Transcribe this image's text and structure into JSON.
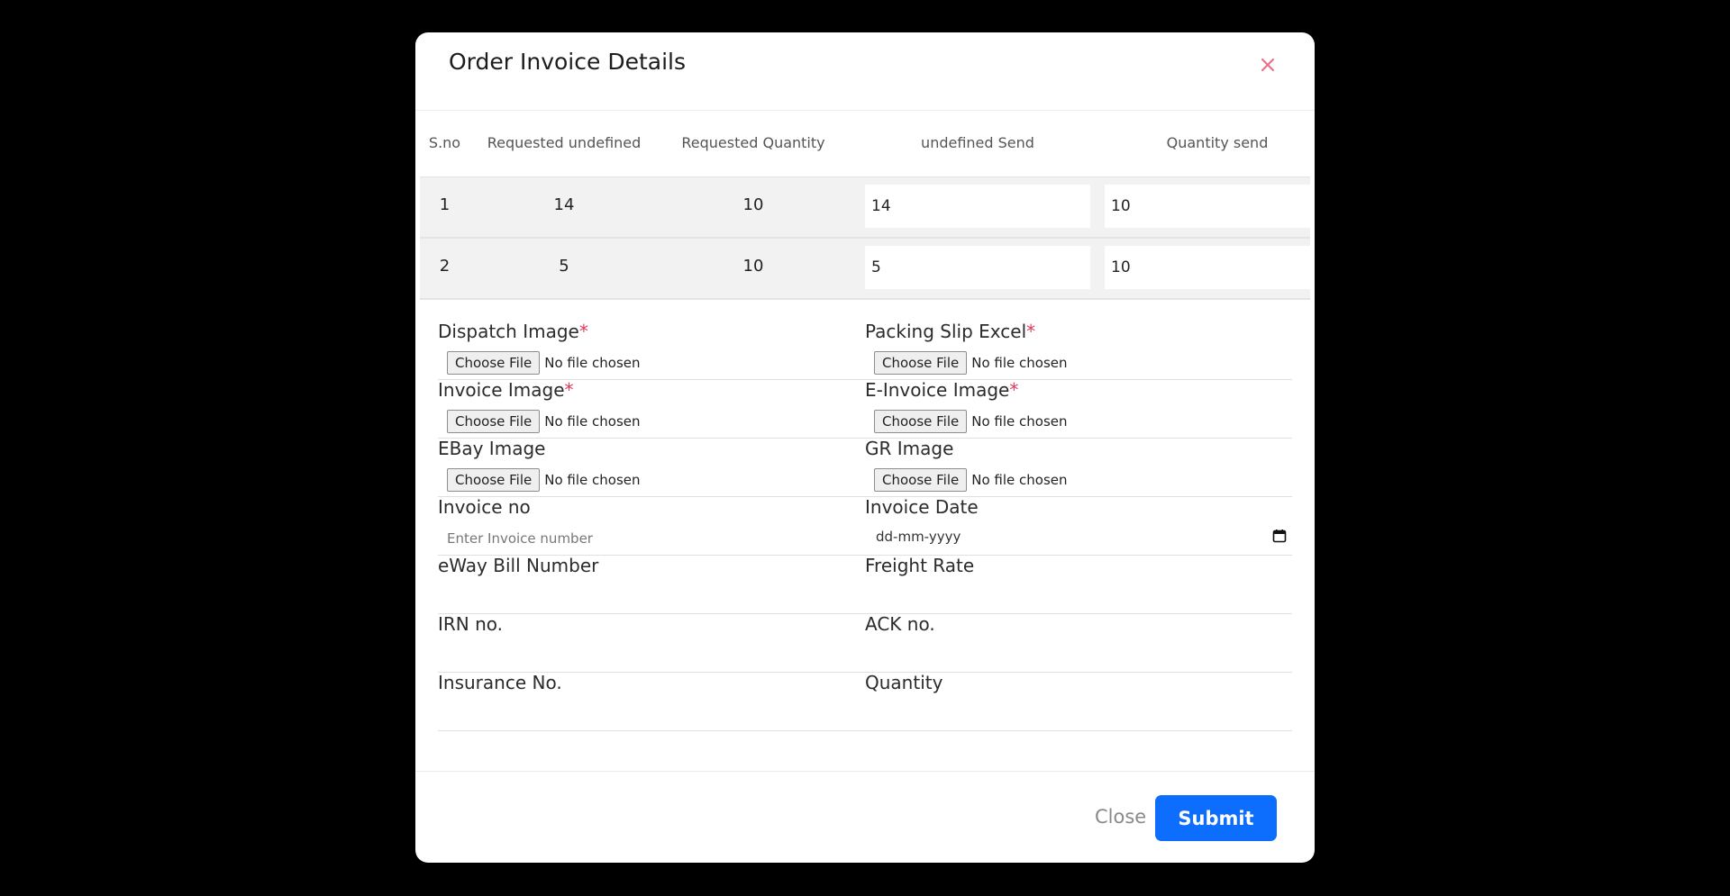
{
  "modal": {
    "title": "Order Invoice Details",
    "close_label": "Close",
    "submit_label": "Submit",
    "colors": {
      "accent": "#0d6efd",
      "required": "#e03a5b",
      "close_icon": "#e9738a"
    }
  },
  "table": {
    "headers": [
      "S.no",
      "Requested undefined",
      "Requested Quantity",
      "undefined Send",
      "Quantity send"
    ],
    "rows": [
      {
        "sno": "1",
        "requested_undefined": "14",
        "requested_quantity": "10",
        "undefined_send": "14",
        "quantity_send": "10"
      },
      {
        "sno": "2",
        "requested_undefined": "5",
        "requested_quantity": "10",
        "undefined_send": "5",
        "quantity_send": "10"
      }
    ]
  },
  "form": {
    "file_button_label": "Choose File",
    "no_file_text": "No file chosen",
    "required_mark": "*",
    "dispatch_image": "Dispatch Image",
    "packing_slip_excel": "Packing Slip Excel",
    "invoice_image": "Invoice Image",
    "e_invoice_image": "E-Invoice Image",
    "ebay_image": "EBay Image",
    "gr_image": "GR Image",
    "invoice_no": "Invoice no",
    "invoice_no_placeholder": "Enter Invoice number",
    "invoice_date": "Invoice Date",
    "invoice_date_placeholder": "dd-mm-yyyy",
    "eway_bill_number": "eWay Bill Number",
    "freight_rate": "Freight Rate",
    "irn_no": "IRN no.",
    "ack_no": "ACK no.",
    "insurance_no": "Insurance No.",
    "quantity": "Quantity"
  }
}
